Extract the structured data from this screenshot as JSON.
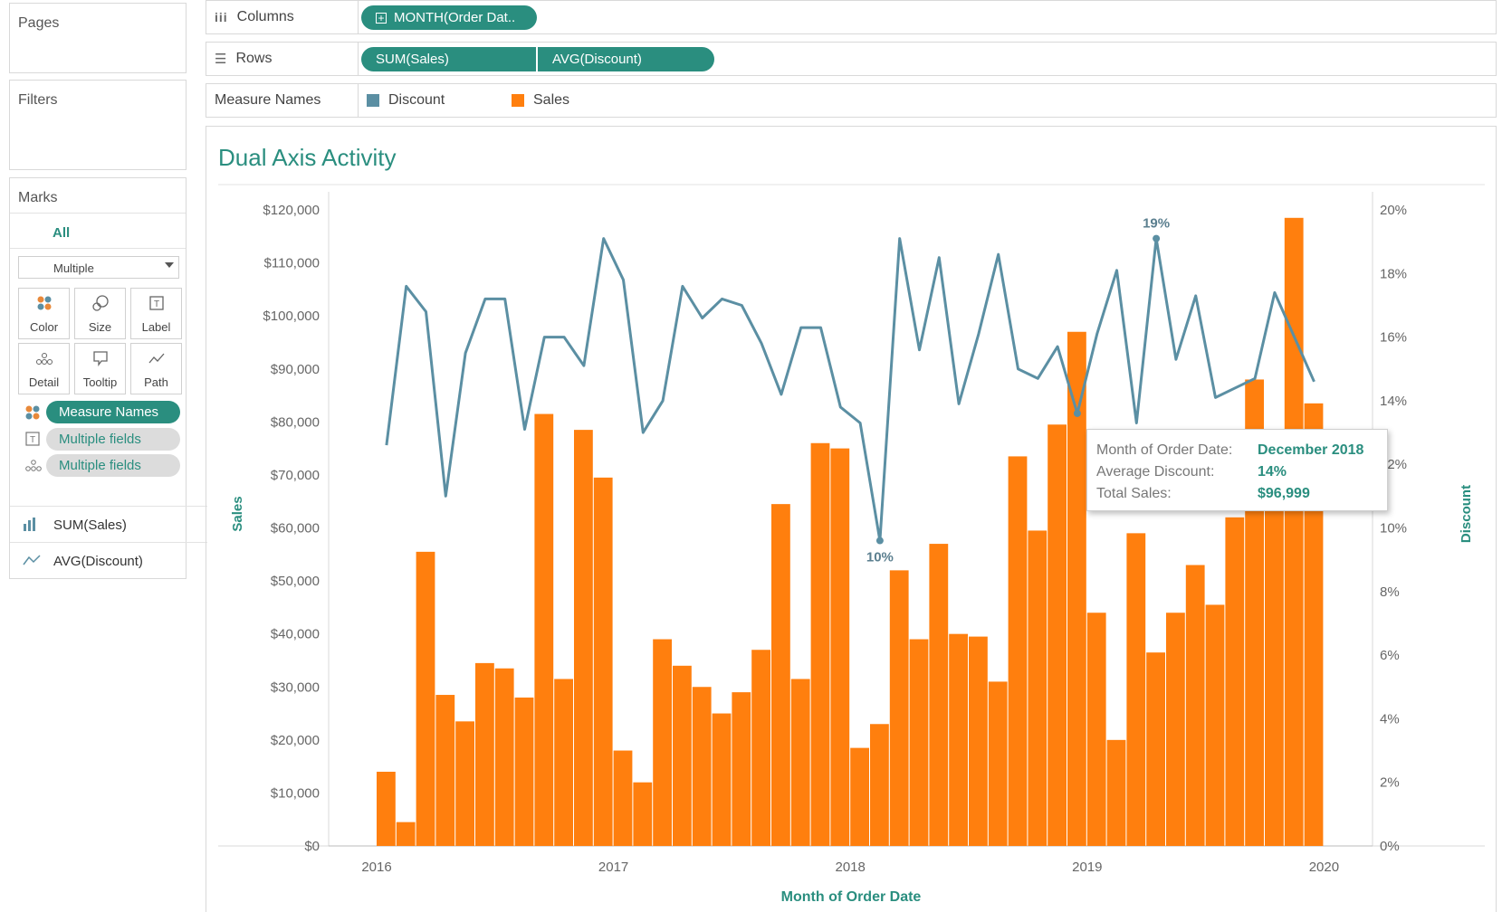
{
  "pages": {
    "title": "Pages"
  },
  "filters": {
    "title": "Filters"
  },
  "marks": {
    "title": "Marks",
    "all_label": "All",
    "mark_type": "Multiple",
    "buttons": [
      {
        "label": "Color",
        "icon": "color-icon"
      },
      {
        "label": "Size",
        "icon": "size-icon"
      },
      {
        "label": "Label",
        "icon": "label-icon"
      },
      {
        "label": "Detail",
        "icon": "detail-icon"
      },
      {
        "label": "Tooltip",
        "icon": "tooltip-icon"
      },
      {
        "label": "Path",
        "icon": "path-icon"
      }
    ],
    "fields": [
      {
        "label": "Measure Names",
        "icon": "color-icon"
      },
      {
        "label": "Multiple fields",
        "icon": "label-icon"
      },
      {
        "label": "Multiple fields",
        "icon": "detail-icon"
      }
    ],
    "measures": [
      {
        "label": "SUM(Sales)",
        "icon": "bar-chart-icon"
      },
      {
        "label": "AVG(Discount)",
        "icon": "line-chart-icon"
      }
    ]
  },
  "shelves": {
    "columns": {
      "label": "Columns",
      "pills": [
        "MONTH(Order Dat.."
      ]
    },
    "rows": {
      "label": "Rows",
      "pills": [
        "SUM(Sales)",
        "AVG(Discount)"
      ]
    },
    "legend": {
      "label": "Measure Names",
      "items": [
        {
          "label": "Discount",
          "color": "#5b8fa3"
        },
        {
          "label": "Sales",
          "color": "#ff7f0e"
        }
      ]
    }
  },
  "tooltip": {
    "rows": [
      {
        "key": "Month of Order Date:",
        "value": "December 2018"
      },
      {
        "key": "Average Discount:",
        "value": "14%"
      },
      {
        "key": "Total Sales:",
        "value": "$96,999"
      }
    ]
  },
  "colors": {
    "sales": "#ff7f0e",
    "discount": "#5b8fa3",
    "accent": "#2a8e7f"
  },
  "chart_data": {
    "type": "bar",
    "title": "Dual Axis Activity",
    "xlabel": "Month of Order Date",
    "ylabel": "Sales",
    "y2label": "Discount",
    "x_ticks": [
      "2016",
      "2017",
      "2018",
      "2019",
      "2020"
    ],
    "y_ticks": [
      "$0",
      "$10,000",
      "$20,000",
      "$30,000",
      "$40,000",
      "$50,000",
      "$60,000",
      "$70,000",
      "$80,000",
      "$90,000",
      "$100,000",
      "$110,000",
      "$120,000"
    ],
    "y2_ticks": [
      "0%",
      "2%",
      "4%",
      "6%",
      "8%",
      "10%",
      "12%",
      "14%",
      "16%",
      "18%",
      "20%"
    ],
    "ylim": [
      0,
      120000
    ],
    "y2lim": [
      0,
      20
    ],
    "months": [
      "Jan 2016",
      "Feb 2016",
      "Mar 2016",
      "Apr 2016",
      "May 2016",
      "Jun 2016",
      "Jul 2016",
      "Aug 2016",
      "Sep 2016",
      "Oct 2016",
      "Nov 2016",
      "Dec 2016",
      "Jan 2017",
      "Feb 2017",
      "Mar 2017",
      "Apr 2017",
      "May 2017",
      "Jun 2017",
      "Jul 2017",
      "Aug 2017",
      "Sep 2017",
      "Oct 2017",
      "Nov 2017",
      "Dec 2017",
      "Jan 2018",
      "Feb 2018",
      "Mar 2018",
      "Apr 2018",
      "May 2018",
      "Jun 2018",
      "Jul 2018",
      "Aug 2018",
      "Sep 2018",
      "Oct 2018",
      "Nov 2018",
      "Dec 2018",
      "Jan 2019",
      "Feb 2019",
      "Mar 2019",
      "Apr 2019",
      "May 2019",
      "Jun 2019",
      "Jul 2019",
      "Aug 2019",
      "Sep 2019",
      "Oct 2019",
      "Nov 2019",
      "Dec 2019"
    ],
    "series": [
      {
        "name": "Sales",
        "axis": "left",
        "mark": "bar",
        "values": [
          14000,
          4500,
          55500,
          28500,
          23500,
          34500,
          33500,
          28000,
          81500,
          31500,
          78500,
          69500,
          18000,
          12000,
          39000,
          34000,
          30000,
          25000,
          29000,
          37000,
          64500,
          31500,
          76000,
          75000,
          18500,
          23000,
          52000,
          39000,
          57000,
          40000,
          39500,
          31000,
          73500,
          59500,
          79500,
          96999,
          44000,
          20000,
          59000,
          36500,
          44000,
          53000,
          45500,
          62000,
          88000,
          66000,
          118500,
          83500
        ]
      },
      {
        "name": "Discount",
        "axis": "right",
        "mark": "line",
        "values": [
          12.6,
          17.6,
          16.8,
          11.0,
          15.5,
          17.2,
          17.2,
          13.1,
          16.0,
          16.0,
          15.1,
          19.1,
          17.8,
          13.0,
          14.0,
          17.6,
          16.6,
          17.2,
          17.0,
          15.8,
          14.2,
          16.3,
          16.3,
          13.8,
          13.3,
          9.6,
          19.1,
          15.6,
          18.5,
          13.9,
          16.1,
          18.6,
          15.0,
          14.7,
          15.7,
          13.6,
          16.1,
          18.1,
          13.3,
          19.1,
          15.3,
          17.3,
          14.1,
          14.4,
          14.7,
          17.4,
          16.0,
          14.6
        ]
      }
    ],
    "annotations": [
      {
        "month": "Feb 2018",
        "label": "10%"
      },
      {
        "month": "Apr 2019",
        "label": "19%"
      }
    ]
  }
}
